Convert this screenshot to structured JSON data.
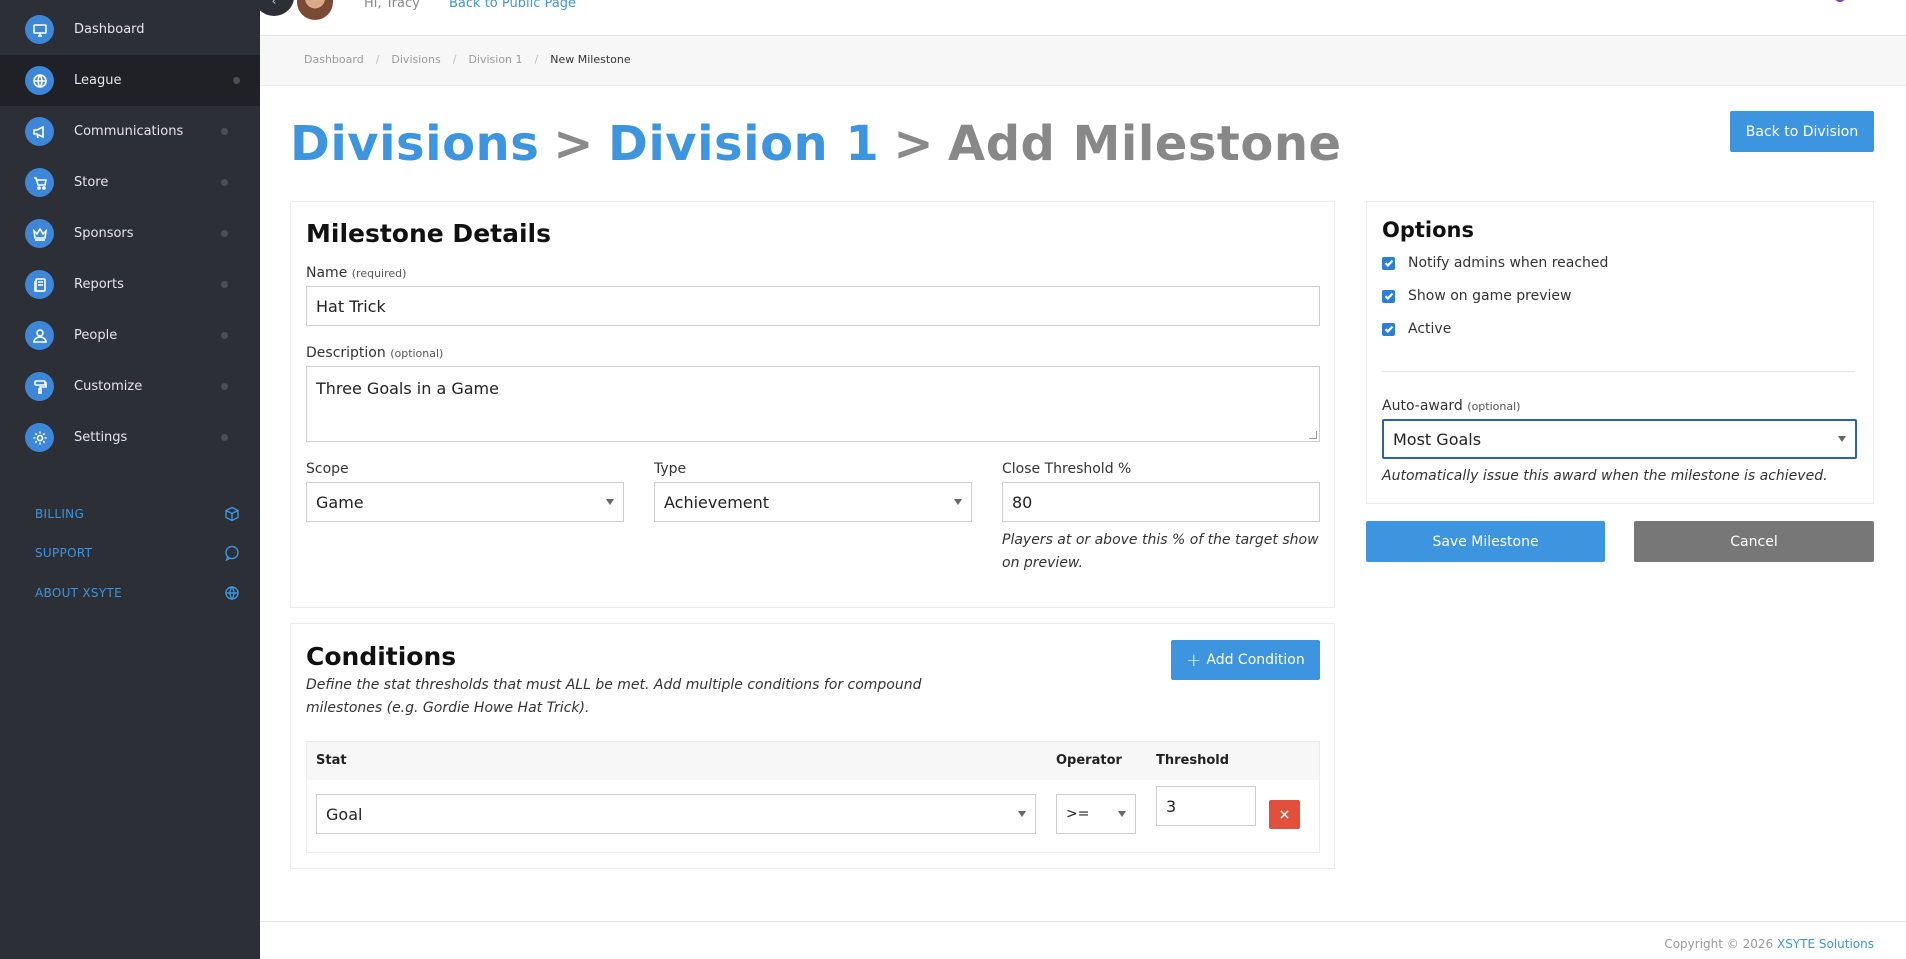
{
  "sidebar": {
    "items": [
      {
        "label": "Dashboard",
        "icon": "monitor-icon"
      },
      {
        "label": "League",
        "icon": "globe-icon"
      },
      {
        "label": "Communications",
        "icon": "megaphone-icon"
      },
      {
        "label": "Store",
        "icon": "cart-icon"
      },
      {
        "label": "Sponsors",
        "icon": "crown-icon"
      },
      {
        "label": "Reports",
        "icon": "report-icon"
      },
      {
        "label": "People",
        "icon": "person-icon"
      },
      {
        "label": "Customize",
        "icon": "paint-roller-icon"
      },
      {
        "label": "Settings",
        "icon": "gear-icon"
      }
    ],
    "active_item": "League",
    "links": [
      {
        "label": "BILLING",
        "icon": "cube-icon"
      },
      {
        "label": "SUPPORT",
        "icon": "chat-icon"
      },
      {
        "label": "ABOUT XSYTE",
        "icon": "globe-icon"
      }
    ]
  },
  "topbar": {
    "greeting": "Hi, Tracy",
    "public_link": "Back to Public Page",
    "collapse_glyph": "‹"
  },
  "breadcrumb": {
    "items": [
      "Dashboard",
      "Divisions",
      "Division 1"
    ],
    "current": "New Milestone",
    "separator": "/"
  },
  "page_title": {
    "part1": "Divisions",
    "part2": "Division 1",
    "part3": "Add Milestone",
    "separator": ">"
  },
  "back_button": "Back to Division",
  "details": {
    "title": "Milestone Details",
    "name_label": "Name",
    "name_hint": "(required)",
    "name_value": "Hat Trick",
    "description_label": "Description",
    "description_hint": "(optional)",
    "description_value": "Three Goals in a Game",
    "scope_label": "Scope",
    "scope_value": "Game",
    "type_label": "Type",
    "type_value": "Achievement",
    "threshold_label": "Close Threshold %",
    "threshold_value": "80",
    "threshold_help": "Players at or above this % of the target show on preview."
  },
  "options": {
    "title": "Options",
    "checks": [
      {
        "label": "Notify admins when reached",
        "checked": true
      },
      {
        "label": "Show on game preview",
        "checked": true
      },
      {
        "label": "Active",
        "checked": true
      }
    ],
    "auto_award_label": "Auto-award",
    "auto_award_hint": "(optional)",
    "auto_award_value": "Most Goals",
    "auto_award_help": "Automatically issue this award when the milestone is achieved."
  },
  "actions": {
    "save": "Save Milestone",
    "cancel": "Cancel"
  },
  "conditions": {
    "title": "Conditions",
    "description": "Define the stat thresholds that must ALL be met. Add multiple conditions for compound milestones (e.g. Gordie Howe Hat Trick).",
    "add_button": "Add Condition",
    "columns": [
      "Stat",
      "Operator",
      "Threshold"
    ],
    "rows": [
      {
        "stat": "Goal",
        "operator": ">=",
        "threshold": "3"
      }
    ]
  },
  "footer": {
    "copyright": "Copyright © 2026",
    "company": "XSYTE Solutions"
  },
  "colors": {
    "accent": "#3d95e0",
    "sidebar_bg": "#2c2f36",
    "danger": "#e24f3b"
  }
}
